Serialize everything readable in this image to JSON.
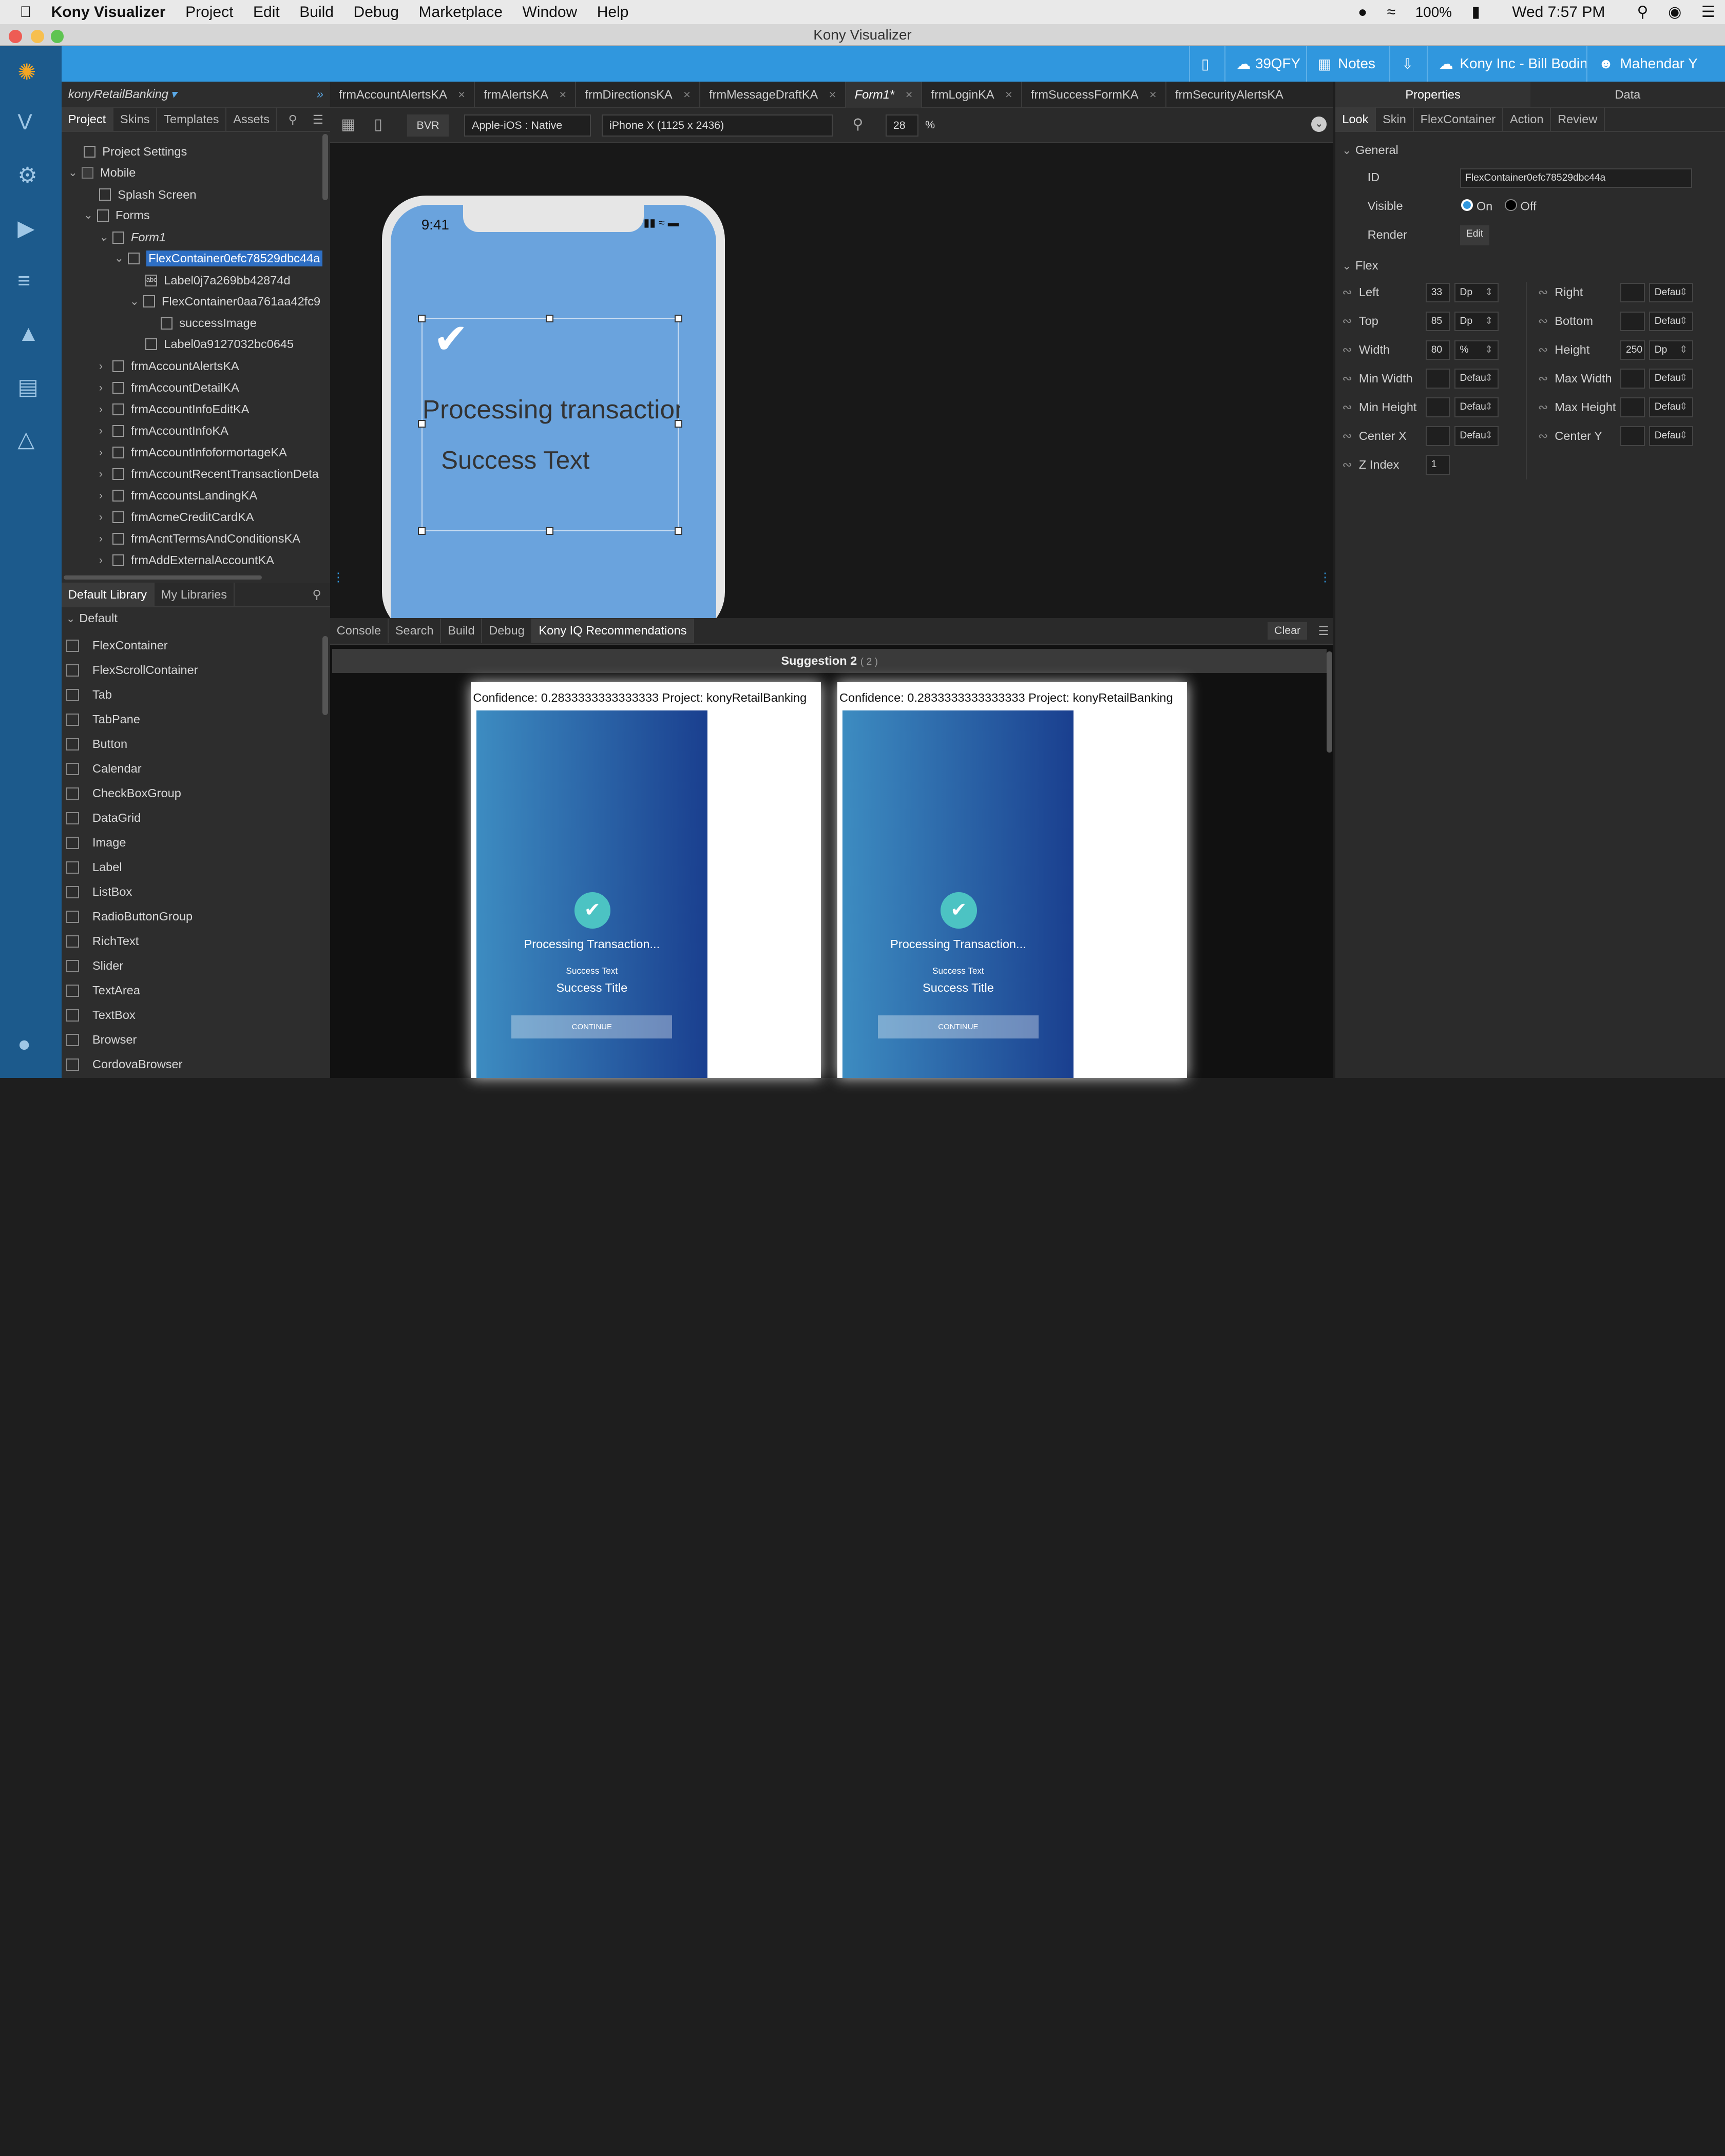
{
  "menubar": {
    "app": "Kony Visualizer",
    "items": [
      "Project",
      "Edit",
      "Build",
      "Debug",
      "Marketplace",
      "Window",
      "Help"
    ],
    "battery": "100%",
    "clock": "Wed 7:57 PM"
  },
  "window": {
    "title": "Kony Visualizer"
  },
  "topbar": {
    "cloud_id": "39QFY",
    "notes": "Notes",
    "account": "Kony Inc - Bill Bodin",
    "user": "Mahendar Y"
  },
  "project": {
    "name": "konyRetailBanking",
    "tabs": [
      "Project",
      "Skins",
      "Templates",
      "Assets"
    ],
    "tree": {
      "settings": "Project Settings",
      "mobile": "Mobile",
      "splash": "Splash Screen",
      "forms": "Forms",
      "form1": "Form1",
      "flex1": "FlexContainer0efc78529dbc44a",
      "label1": "Label0j7a269bb42874d",
      "flex2": "FlexContainer0aa761aa42fc9",
      "image": "successImage",
      "label2": "Label0a9127032bc0645",
      "forms_list": [
        "frmAccountAlertsKA",
        "frmAccountDetailKA",
        "frmAccountInfoEditKA",
        "frmAccountInfoKA",
        "frmAccountInfoformortageKA",
        "frmAccountRecentTransactionDeta",
        "frmAccountsLandingKA",
        "frmAcmeCreditCardKA",
        "frmAcntTermsAndConditionsKA",
        "frmAddExternalAccountKA"
      ]
    }
  },
  "library": {
    "tabs": [
      "Default Library",
      "My Libraries"
    ],
    "group": "Default",
    "items": [
      "FlexContainer",
      "FlexScrollContainer",
      "Tab",
      "TabPane",
      "Button",
      "Calendar",
      "CheckBoxGroup",
      "DataGrid",
      "Image",
      "Label",
      "ListBox",
      "RadioButtonGroup",
      "RichText",
      "Slider",
      "TextArea",
      "TextBox",
      "Browser",
      "CordovaBrowser"
    ]
  },
  "form_tabs": [
    "frmAccountAlertsKA",
    "frmAlertsKA",
    "frmDirectionsKA",
    "frmMessageDraftKA",
    "Form1*",
    "frmLoginKA",
    "frmSuccessFormKA",
    "frmSecurityAlertsKA"
  ],
  "toolbar": {
    "bvr": "BVR",
    "platform": "Apple-iOS : Native",
    "device": "iPhone X (1125 x 2436)",
    "zoom": "28",
    "zoom_unit": "%"
  },
  "device_preview": {
    "time": "9:41",
    "heading": "Processing transaction",
    "sub": "Success Text"
  },
  "bottom": {
    "tabs": [
      "Console",
      "Search",
      "Build",
      "Debug",
      "Kony IQ Recommendations"
    ],
    "clear": "Clear",
    "suggestion_title": "Suggestion 2",
    "suggestion_count": "( 2 )",
    "cards": [
      {
        "confidence": "Confidence: 0.2833333333333333 Project: konyRetailBanking",
        "processing": "Processing Transaction...",
        "success_text": "Success Text",
        "success_title": "Success Title",
        "button": "CONTINUE"
      },
      {
        "confidence": "Confidence: 0.2833333333333333 Project: konyRetailBanking",
        "processing": "Processing Transaction...",
        "success_text": "Success Text",
        "success_title": "Success Title",
        "button": "CONTINUE"
      }
    ]
  },
  "properties": {
    "tabs": [
      "Properties",
      "Data"
    ],
    "subtabs": [
      "Look",
      "Skin",
      "FlexContainer",
      "Action",
      "Review"
    ],
    "general": "General",
    "id_label": "ID",
    "id_value": "FlexContainer0efc78529dbc44a",
    "visible_label": "Visible",
    "on": "On",
    "off": "Off",
    "render_label": "Render",
    "edit": "Edit",
    "flex": "Flex",
    "left": {
      "label": "Left",
      "value": "33",
      "unit": "Dp"
    },
    "top": {
      "label": "Top",
      "value": "85",
      "unit": "Dp"
    },
    "width": {
      "label": "Width",
      "value": "80",
      "unit": "%"
    },
    "minwidth": {
      "label": "Min Width",
      "unit": "Defau"
    },
    "minheight": {
      "label": "Min Height",
      "unit": "Defau"
    },
    "centerx": {
      "label": "Center X",
      "unit": "Defau"
    },
    "zindex": {
      "label": "Z Index",
      "value": "1"
    },
    "right": {
      "label": "Right",
      "unit": "Defau"
    },
    "bottom": {
      "label": "Bottom",
      "unit": "Defau"
    },
    "height": {
      "label": "Height",
      "value": "250",
      "unit": "Dp"
    },
    "maxwidth": {
      "label": "Max Width",
      "unit": "Defau"
    },
    "maxheight": {
      "label": "Max Height",
      "unit": "Defau"
    },
    "centery": {
      "label": "Center Y",
      "unit": "Defau"
    }
  },
  "colors": {
    "accent": "#3097de",
    "nav": "#1c5a8c",
    "selection": "#2e6fc4",
    "phone_bg": "#6aa3dd"
  }
}
